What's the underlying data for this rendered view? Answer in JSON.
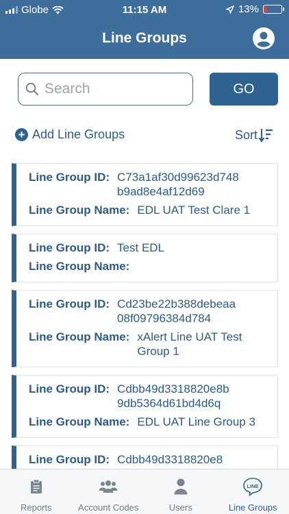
{
  "status": {
    "carrier": "Globe",
    "time": "11:15 AM",
    "battery": "13%",
    "battery_level": 0.13
  },
  "header": {
    "title": "Line Groups"
  },
  "search": {
    "placeholder": "Search",
    "value": "",
    "go_label": "GO"
  },
  "actions": {
    "add_label": "Add Line Groups",
    "sort_label": "Sort"
  },
  "labels": {
    "id": "Line Group ID:",
    "name": "Line Group Name:"
  },
  "cards": [
    {
      "id": "C73a1af30d99623d748b9ad8e4af12d69",
      "name": "EDL UAT Test Clare 1"
    },
    {
      "id": "Test EDL",
      "name": ""
    },
    {
      "id": "Cd23be22b388debeaa08f09796384d784",
      "name": "xAlert Line UAT Test Group 1"
    },
    {
      "id": "Cdbb49d3318820e8b9db5364d61bd4d6q",
      "name": "EDL UAT Line Group 3"
    },
    {
      "id": "Cdbb49d3318820e8",
      "name": ""
    }
  ],
  "tabs": [
    {
      "label": "Reports",
      "icon": "clipboard-icon"
    },
    {
      "label": "Account Codes",
      "icon": "group-icon"
    },
    {
      "label": "Users",
      "icon": "user-icon"
    },
    {
      "label": "Line Groups",
      "icon": "line-icon",
      "active": true
    }
  ]
}
